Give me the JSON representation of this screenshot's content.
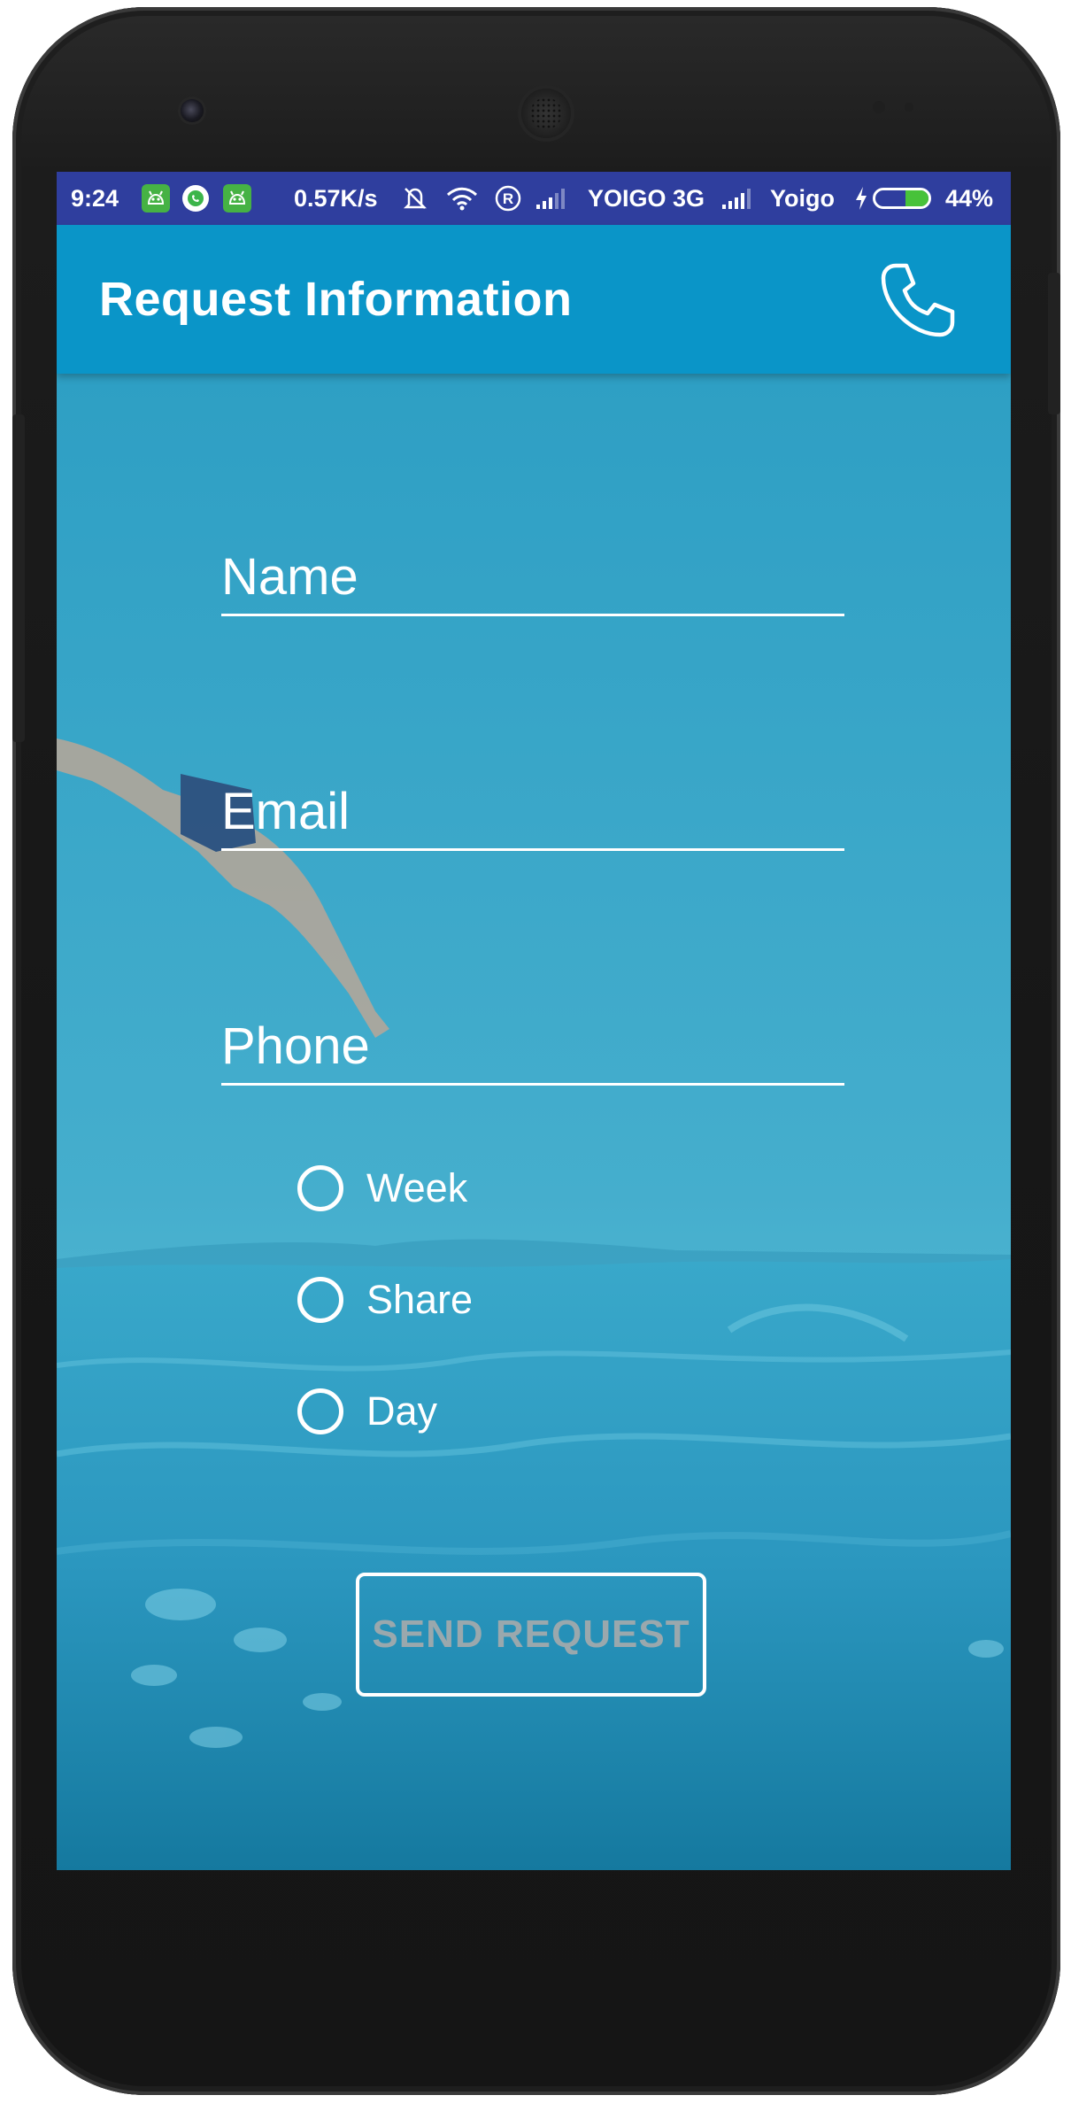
{
  "status_bar": {
    "time": "9:24",
    "net_speed": "0.57K/s",
    "carrier_1": "YOIGO 3G",
    "carrier_2": "Yoigo",
    "battery_text": "44%",
    "battery_level": 0.44,
    "icons": [
      "android-notification-icon",
      "whatsapp-icon",
      "android-notification-icon",
      "mute-icon",
      "wifi-icon",
      "roaming-icon",
      "signal-icon",
      "signal-icon",
      "charging-icon",
      "battery-icon"
    ]
  },
  "toolbar": {
    "title": "Request Information",
    "action_icon": "phone-icon"
  },
  "form": {
    "name_placeholder": "Name",
    "email_placeholder": "Email",
    "phone_placeholder": "Phone",
    "options": [
      "Week",
      "Share",
      "Day"
    ],
    "submit_label": "SEND REQUEST"
  },
  "colors": {
    "status_bar": "#2f3e9e",
    "toolbar": "#0a95c8",
    "background_sea": "#3aa6c8",
    "button_text": "#9aa8ad"
  }
}
